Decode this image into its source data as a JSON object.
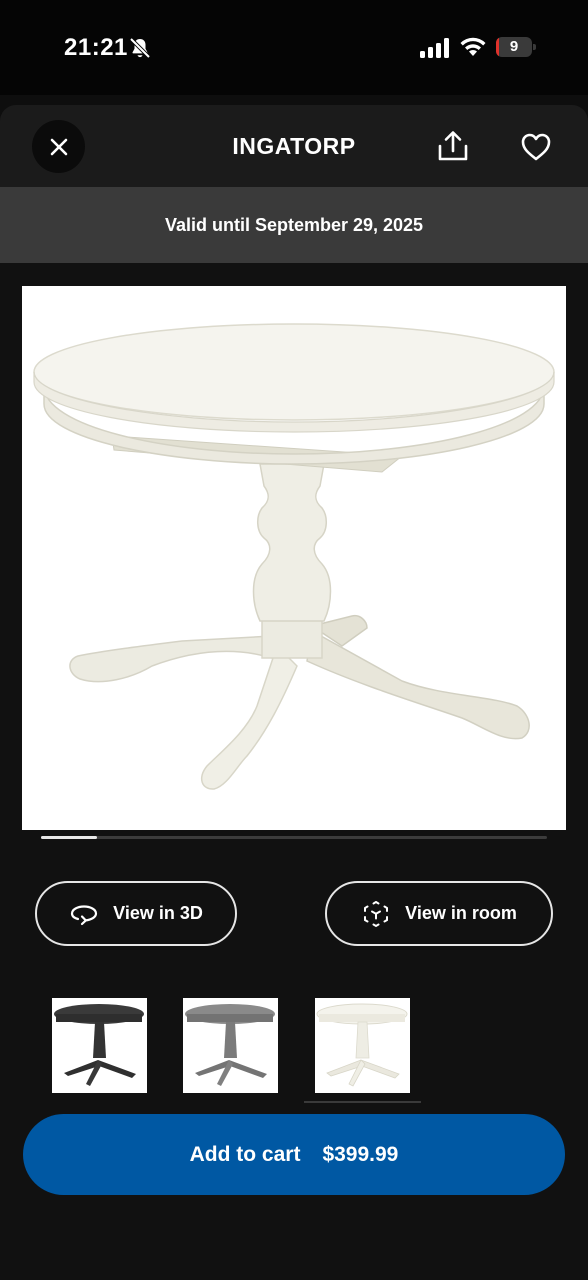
{
  "status_bar": {
    "time": "21:21",
    "battery_level": "9",
    "battery_fraction": 0.09,
    "icons": [
      "bell-slash-icon",
      "cellular-signal-icon",
      "wifi-icon",
      "battery-icon"
    ]
  },
  "header": {
    "title": "INGATORP",
    "close_icon": "close-icon",
    "share_icon": "share-icon",
    "favorite_icon": "heart-icon"
  },
  "banner": {
    "text": "Valid until September 29, 2025"
  },
  "gallery": {
    "image": "white round extendable pedestal table",
    "progress_fraction": 0.11
  },
  "actions": {
    "view_3d_label": "View in 3D",
    "view_3d_icon": "rotate-3d-icon",
    "view_room_label": "View in room",
    "view_room_icon": "augmented-reality-icon"
  },
  "variants": [
    {
      "color": "black-brown",
      "hex": "#3a3a3a",
      "selected": false
    },
    {
      "color": "grey",
      "hex": "#7d7d7d",
      "selected": false
    },
    {
      "color": "white",
      "hex": "#f1f0e7",
      "selected": true
    }
  ],
  "cart": {
    "label": "Add to cart",
    "price": "$399.99",
    "color": "#0058a3"
  },
  "colors": {
    "background": "#111111",
    "header": "#1b1b1b",
    "banner": "#3a3a3a",
    "accent": "#0058a3"
  }
}
